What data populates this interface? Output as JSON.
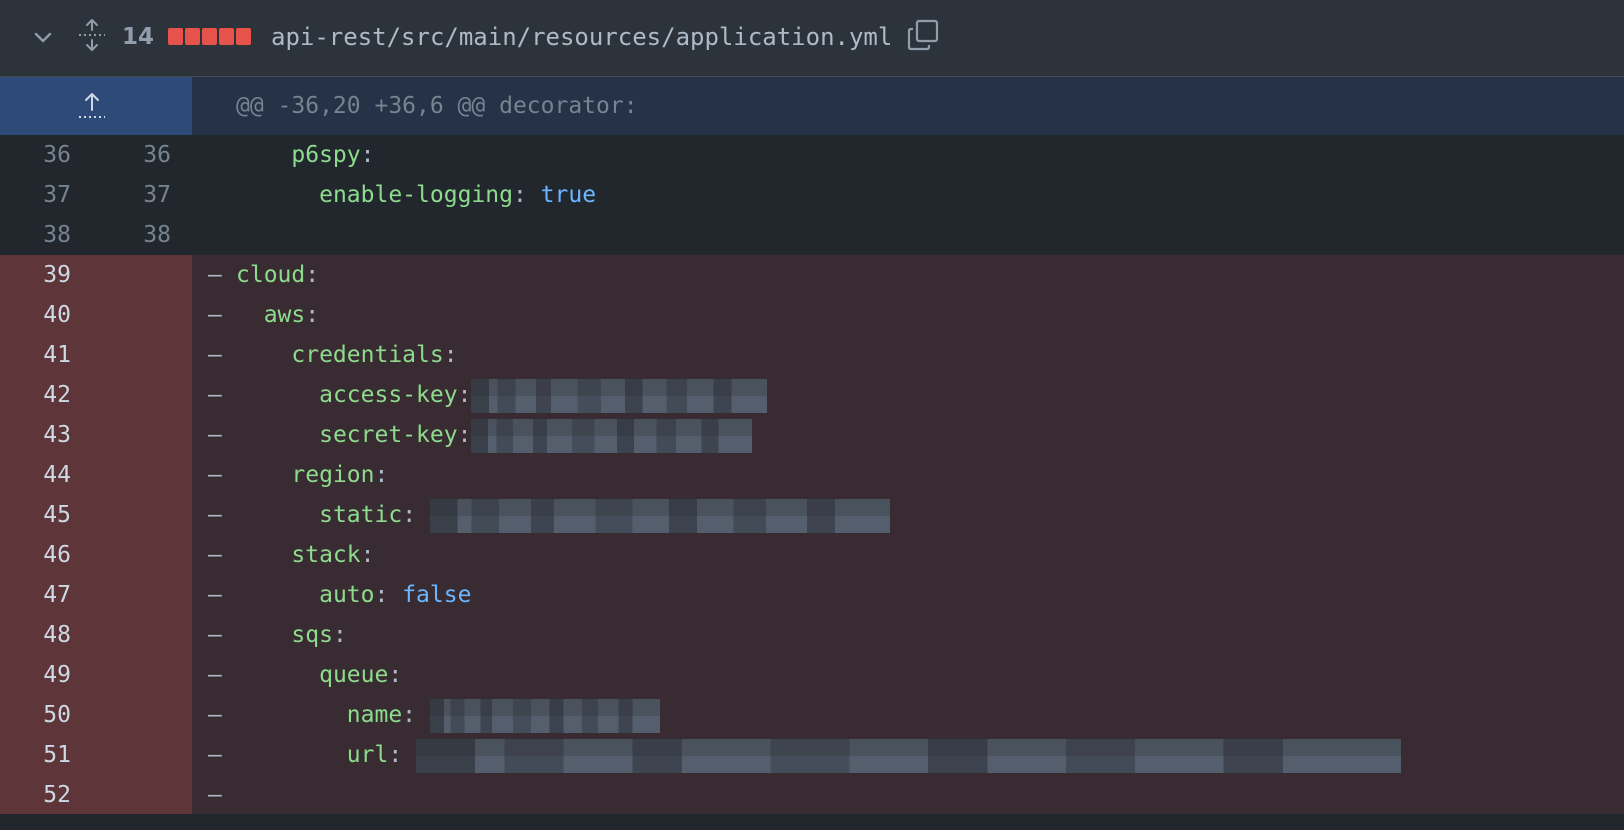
{
  "file_header": {
    "change_count": "14",
    "diffstat": [
      "deleted",
      "deleted",
      "deleted",
      "deleted",
      "deleted"
    ],
    "file_path": "api-rest/src/main/resources/application.yml",
    "icons": [
      "chevron-down-icon",
      "expand-all-icon",
      "copy-icon"
    ]
  },
  "hunk": {
    "header": "@@ -36,20 +36,6 @@ decorator:",
    "expand_icon": "expand-up-icon"
  },
  "lines": [
    {
      "old": "36",
      "new": "36",
      "type": "context",
      "marker": "",
      "indent": "    ",
      "key": "p6spy",
      "sep": ":",
      "value": ""
    },
    {
      "old": "37",
      "new": "37",
      "type": "context",
      "marker": "",
      "indent": "      ",
      "key": "enable-logging",
      "sep": ": ",
      "value": "true"
    },
    {
      "old": "38",
      "new": "38",
      "type": "context",
      "marker": "",
      "indent": "",
      "key": "",
      "sep": "",
      "value": ""
    },
    {
      "old": "39",
      "new": "",
      "type": "deleted",
      "marker": "–",
      "indent": "",
      "key": "cloud",
      "sep": ":",
      "value": ""
    },
    {
      "old": "40",
      "new": "",
      "type": "deleted",
      "marker": "–",
      "indent": "  ",
      "key": "aws",
      "sep": ":",
      "value": ""
    },
    {
      "old": "41",
      "new": "",
      "type": "deleted",
      "marker": "–",
      "indent": "    ",
      "key": "credentials",
      "sep": ":",
      "value": ""
    },
    {
      "old": "42",
      "new": "",
      "type": "deleted",
      "marker": "–",
      "indent": "      ",
      "key": "access-key",
      "sep": ":",
      "value": "",
      "redacted": true
    },
    {
      "old": "43",
      "new": "",
      "type": "deleted",
      "marker": "–",
      "indent": "      ",
      "key": "secret-key",
      "sep": ":",
      "value": "",
      "redacted": true
    },
    {
      "old": "44",
      "new": "",
      "type": "deleted",
      "marker": "–",
      "indent": "    ",
      "key": "region",
      "sep": ":",
      "value": ""
    },
    {
      "old": "45",
      "new": "",
      "type": "deleted",
      "marker": "–",
      "indent": "      ",
      "key": "static",
      "sep": ": ",
      "value": "",
      "redacted": true
    },
    {
      "old": "46",
      "new": "",
      "type": "deleted",
      "marker": "–",
      "indent": "    ",
      "key": "stack",
      "sep": ":",
      "value": ""
    },
    {
      "old": "47",
      "new": "",
      "type": "deleted",
      "marker": "–",
      "indent": "      ",
      "key": "auto",
      "sep": ": ",
      "value": "false"
    },
    {
      "old": "48",
      "new": "",
      "type": "deleted",
      "marker": "–",
      "indent": "    ",
      "key": "sqs",
      "sep": ":",
      "value": ""
    },
    {
      "old": "49",
      "new": "",
      "type": "deleted",
      "marker": "–",
      "indent": "      ",
      "key": "queue",
      "sep": ":",
      "value": ""
    },
    {
      "old": "50",
      "new": "",
      "type": "deleted",
      "marker": "–",
      "indent": "        ",
      "key": "name",
      "sep": ": ",
      "value": "",
      "redacted": true
    },
    {
      "old": "51",
      "new": "",
      "type": "deleted",
      "marker": "–",
      "indent": "        ",
      "key": "url",
      "sep": ": ",
      "value": "",
      "redacted": true
    },
    {
      "old": "52",
      "new": "",
      "type": "deleted",
      "marker": "–",
      "indent": "",
      "key": "",
      "sep": "",
      "value": ""
    }
  ],
  "colors": {
    "header_bg": "#2d333b",
    "hunk_bg": "#253248",
    "deleted_bg": "#382b32",
    "deleted_gutter": "#5e3538",
    "key": "#8ddb8c",
    "boolean": "#6cb6ff",
    "diffstat_deleted": "#e5534b"
  }
}
